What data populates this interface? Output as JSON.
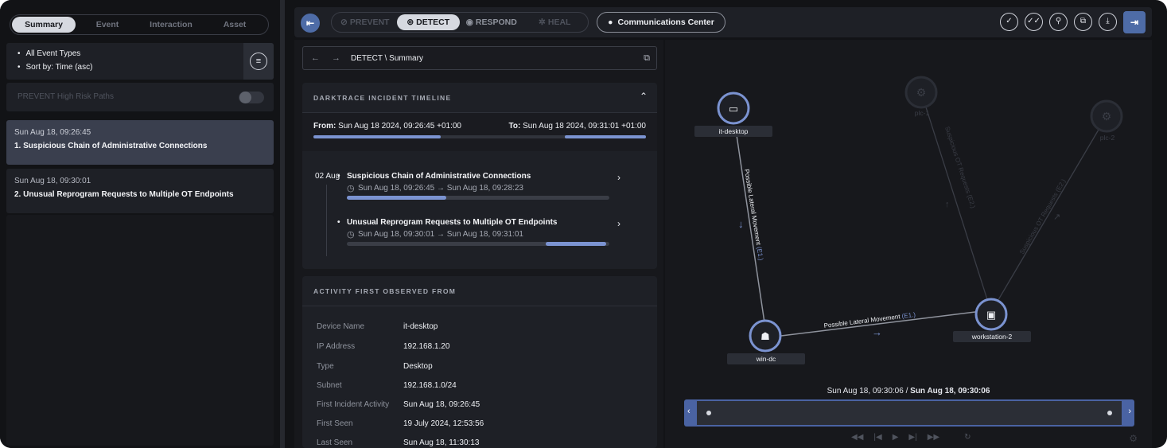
{
  "left": {
    "tabs": [
      "Summary",
      "Event",
      "Interaction",
      "Asset"
    ],
    "filters": [
      "All Event Types",
      "Sort by: Time (asc)"
    ],
    "risk_label": "PREVENT High Risk Paths",
    "incidents": [
      {
        "time": "Sun Aug 18, 09:26:45",
        "title": "1. Suspicious Chain of Administrative Connections"
      },
      {
        "time": "Sun Aug 18, 09:30:01",
        "title": "2. Unusual Reprogram Requests to Multiple OT Endpoints"
      }
    ]
  },
  "toolbar": {
    "phases": [
      "PREVENT",
      "DETECT",
      "RESPOND",
      "HEAL"
    ],
    "comms_label": "Communications Center"
  },
  "middle": {
    "breadcrumb": "DETECT \\ Summary",
    "timeline": {
      "header": "DARKTRACE INCIDENT TIMELINE",
      "from_label": "From:",
      "from_value": "Sun Aug 18 2024, 09:26:45 +01:00",
      "to_label": "To:",
      "to_value": "Sun Aug 18 2024, 09:31:01 +01:00",
      "date": "02 Aug",
      "items": [
        {
          "title": "Suspicious Chain of Administrative Connections",
          "range": "Sun Aug 18, 09:26:45 → Sun Aug 18, 09:28:23",
          "progress_start": 0.0,
          "progress_end": 0.38
        },
        {
          "title": "Unusual Reprogram Requests to Multiple OT Endpoints",
          "range": "Sun Aug 18, 09:30:01 → Sun Aug 18, 09:31:01",
          "progress_start": 0.76,
          "progress_end": 1.0
        }
      ]
    },
    "activity": {
      "header": "ACTIVITY FIRST OBSERVED FROM",
      "rows": [
        {
          "k": "Device Name",
          "v": "it-desktop"
        },
        {
          "k": "IP Address",
          "v": "192.168.1.20"
        },
        {
          "k": "Type",
          "v": "Desktop"
        },
        {
          "k": "Subnet",
          "v": "192.168.1.0/24"
        },
        {
          "k": "First Incident Activity",
          "v": "Sun Aug 18, 09:26:45"
        },
        {
          "k": "First Seen",
          "v": "19 July 2024, 12:53:56"
        },
        {
          "k": "Last Seen",
          "v": "Sun Aug 18, 11:30:13"
        }
      ]
    }
  },
  "graph": {
    "nodes": {
      "it_desktop": "it-desktop",
      "win_dc": "win-dc",
      "workstation_2": "workstation-2",
      "plc_1": "plc-1",
      "plc_2": "plc-2"
    },
    "edges": {
      "e1_label": "Possible Lateral Movement",
      "e1_tag": "(E1.)",
      "e2_label": "Possible Lateral Movement",
      "e2_tag": "(E1.)",
      "e3_label": "Suspicious OT Requests",
      "e3_tag": "(E2.)",
      "e4_label": "Suspicious OT Requests",
      "e4_tag": "(E2.)"
    },
    "playhead_current": "Sun Aug 18, 09:30:06",
    "playhead_separator": " / ",
    "playhead_end": "Sun Aug 18, 09:30:06"
  },
  "colors": {
    "accent": "#4e6ca7",
    "progress": "#7b93d1",
    "background": "#121316",
    "card": "#1e2026"
  }
}
